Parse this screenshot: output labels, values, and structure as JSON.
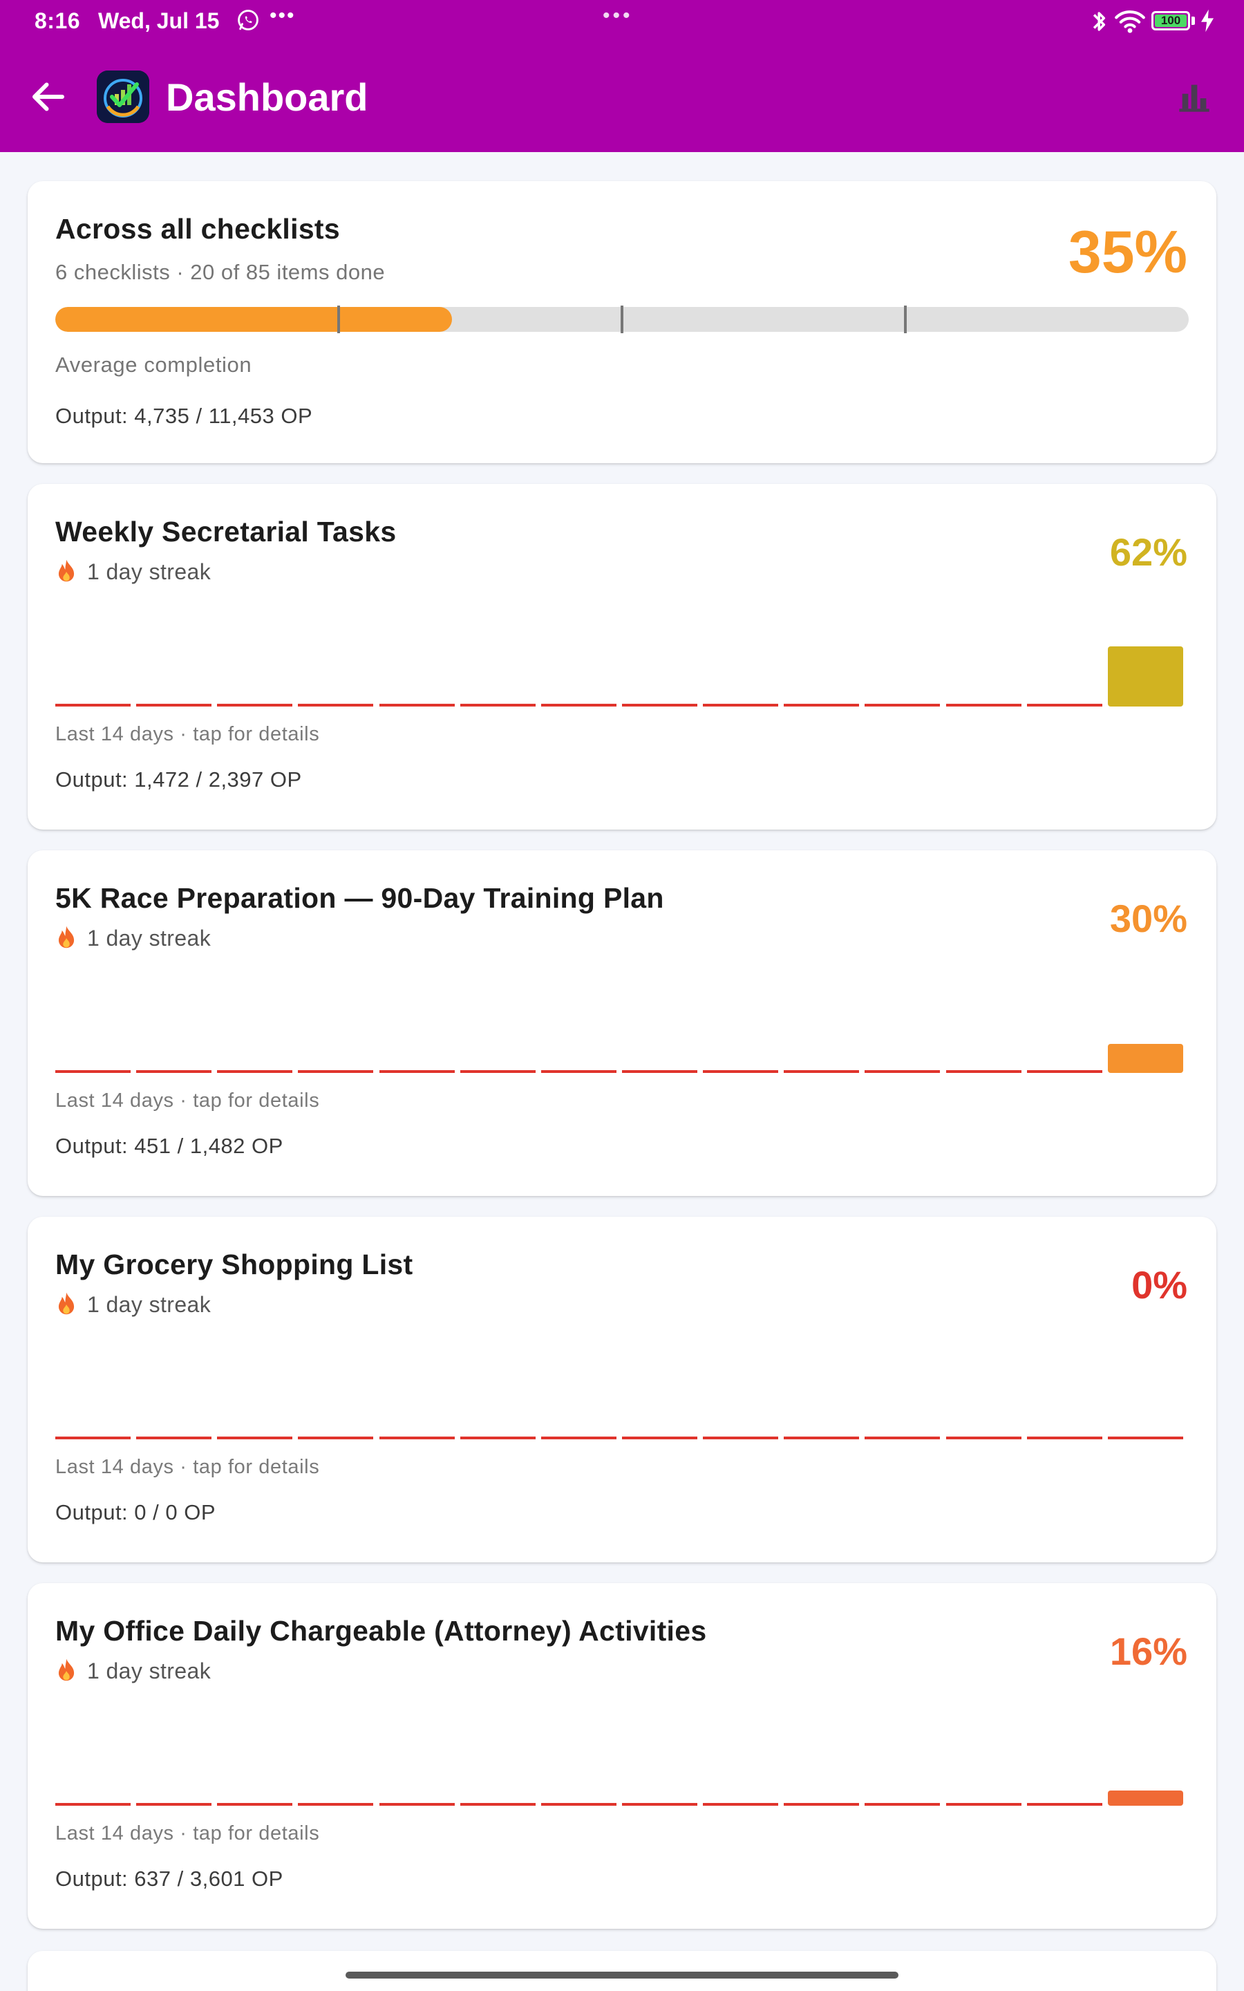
{
  "status_bar": {
    "time": "8:16",
    "date": "Wed, Jul 15",
    "more": "•••",
    "center_dots": "•••",
    "battery": "100"
  },
  "app_bar": {
    "title": "Dashboard",
    "color": "#ab00a9"
  },
  "summary": {
    "title": "Across all checklists",
    "subtitle": "6 checklists · 20 of 85 items done",
    "percent_label": "35%",
    "percent_value": 35,
    "progress_caption": "Average completion",
    "output": "Output: 4,735 / 11,453 OP",
    "color": "#f89a2a"
  },
  "checklists": [
    {
      "title": "Weekly Secretarial Tasks",
      "streak": "1 day streak",
      "percent_label": "62%",
      "percent_value": 62,
      "color": "#d1b321",
      "caption": "Last 14 days · tap for details",
      "output": "Output: 1,472 / 2,397 OP"
    },
    {
      "title": "5K Race Preparation — 90-Day Training Plan",
      "streak": "1 day streak",
      "percent_label": "30%",
      "percent_value": 30,
      "color": "#f5922e",
      "caption": "Last 14 days · tap for details",
      "output": "Output: 451 / 1,482 OP"
    },
    {
      "title": "My Grocery Shopping List",
      "streak": "1 day streak",
      "percent_label": "0%",
      "percent_value": 0,
      "color": "#e0342c",
      "caption": "Last 14 days · tap for details",
      "output": "Output: 0 / 0 OP"
    },
    {
      "title": "My Office Daily Chargeable (Attorney) Activities",
      "streak": "1 day streak",
      "percent_label": "16%",
      "percent_value": 16,
      "color": "#f06a35",
      "caption": "Last 14 days · tap for details",
      "output": "Output: 637 / 3,601 OP"
    }
  ],
  "colors": {
    "track": "#e0e0e0",
    "zero_line": "#e0342c"
  },
  "icons": [
    "back-arrow-icon",
    "app-logo-icon",
    "bar-chart-icon",
    "whatsapp-icon",
    "bluetooth-icon",
    "wifi-icon",
    "battery-icon",
    "charging-icon",
    "flame-icon"
  ]
}
